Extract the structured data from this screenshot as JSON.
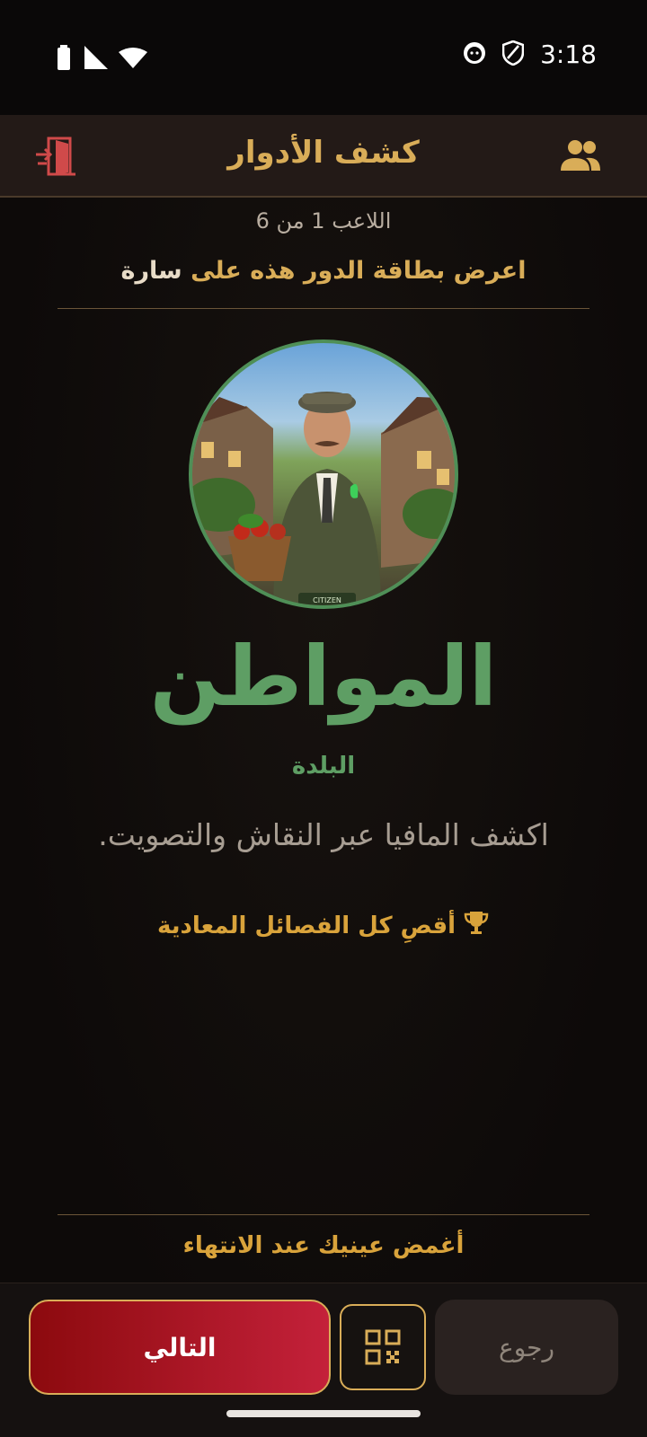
{
  "status_bar": {
    "time": "3:18",
    "icons": [
      "battery-icon",
      "cellular-icon",
      "wifi-icon",
      "app-notification-icon",
      "shield-icon"
    ]
  },
  "app_bar": {
    "title": "كشف الأدوار",
    "left_icon": "exit-door-icon",
    "right_icon": "players-group-icon"
  },
  "progress": {
    "counter": "اللاعب 1 من 6",
    "current": 1,
    "total": 6
  },
  "instruction": {
    "prefix": "اعرض بطاقة الدور هذه على",
    "player_name": "سارة"
  },
  "role": {
    "image_badge": "CITIZEN",
    "name": "المواطن",
    "team": "البلدة",
    "description": "اكشف المافيا عبر النقاش والتصويت.",
    "goal": "أقصِ كل الفصائل المعادية",
    "goal_icon": "trophy-icon"
  },
  "footer_note": "أغمض عينيك عند الانتهاء",
  "buttons": {
    "next": "التالي",
    "qr_icon": "qr-code-icon",
    "back": "رجوع"
  },
  "colors": {
    "gold": "#d9ad58",
    "green": "#5e9e64",
    "red": "#c4213a",
    "background": "#0f0c0b"
  }
}
